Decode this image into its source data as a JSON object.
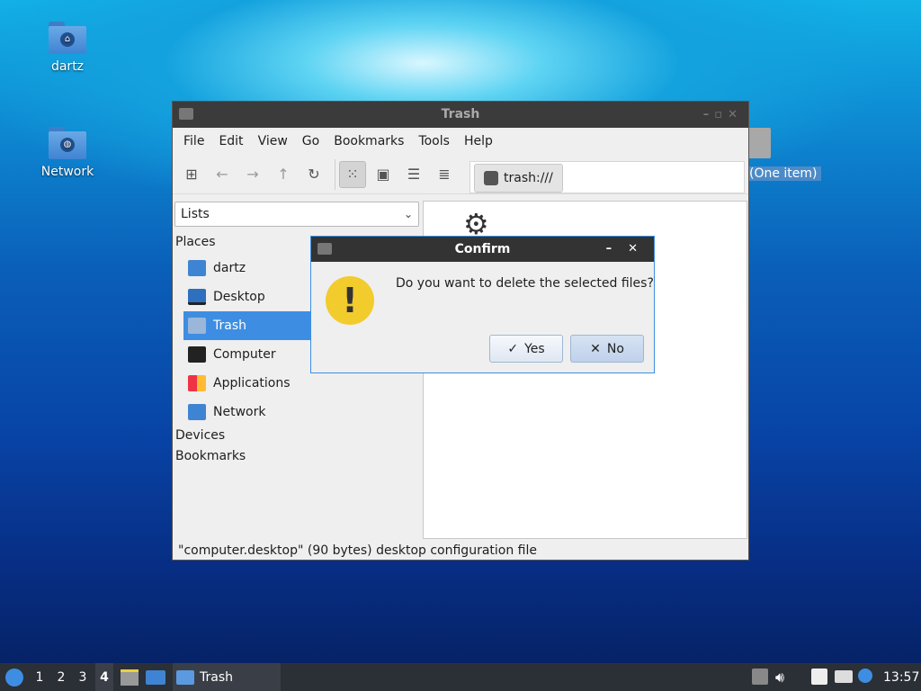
{
  "desktop": {
    "icons": [
      {
        "label": "dartz",
        "icon": "home-folder-icon"
      },
      {
        "label": "Network",
        "icon": "network-folder-icon"
      }
    ],
    "trash_label": "(One item)"
  },
  "window": {
    "title": "Trash",
    "menu": [
      "File",
      "Edit",
      "View",
      "Go",
      "Bookmarks",
      "Tools",
      "Help"
    ],
    "toolbar": {
      "buttons": [
        "new-tab-icon",
        "back-icon",
        "forward-icon",
        "up-icon",
        "reload-icon",
        "icon-view-icon",
        "thumbnail-view-icon",
        "compact-view-icon",
        "detailed-list-icon"
      ]
    },
    "path": "trash:///",
    "side_pane": {
      "mode": "Lists",
      "sections": {
        "places": "Places",
        "devices": "Devices",
        "bookmarks": "Bookmarks"
      },
      "places": [
        {
          "label": "dartz",
          "icon": "home-folder-icon"
        },
        {
          "label": "Desktop",
          "icon": "desktop-icon"
        },
        {
          "label": "Trash",
          "icon": "trash-icon",
          "selected": true
        },
        {
          "label": "Computer",
          "icon": "computer-icon"
        },
        {
          "label": "Applications",
          "icon": "applications-icon"
        },
        {
          "label": "Network",
          "icon": "network-folder-icon"
        }
      ]
    },
    "status": "\"computer.desktop\" (90 bytes) desktop configuration file"
  },
  "dialog": {
    "title": "Confirm",
    "message": "Do you want to delete the selected files?",
    "yes_label": "Yes",
    "no_label": "No",
    "glyph": "!"
  },
  "taskbar": {
    "workspaces": [
      "1",
      "2",
      "3",
      "4"
    ],
    "active_workspace": "4",
    "task_label": "Trash",
    "clock": "13:57"
  }
}
